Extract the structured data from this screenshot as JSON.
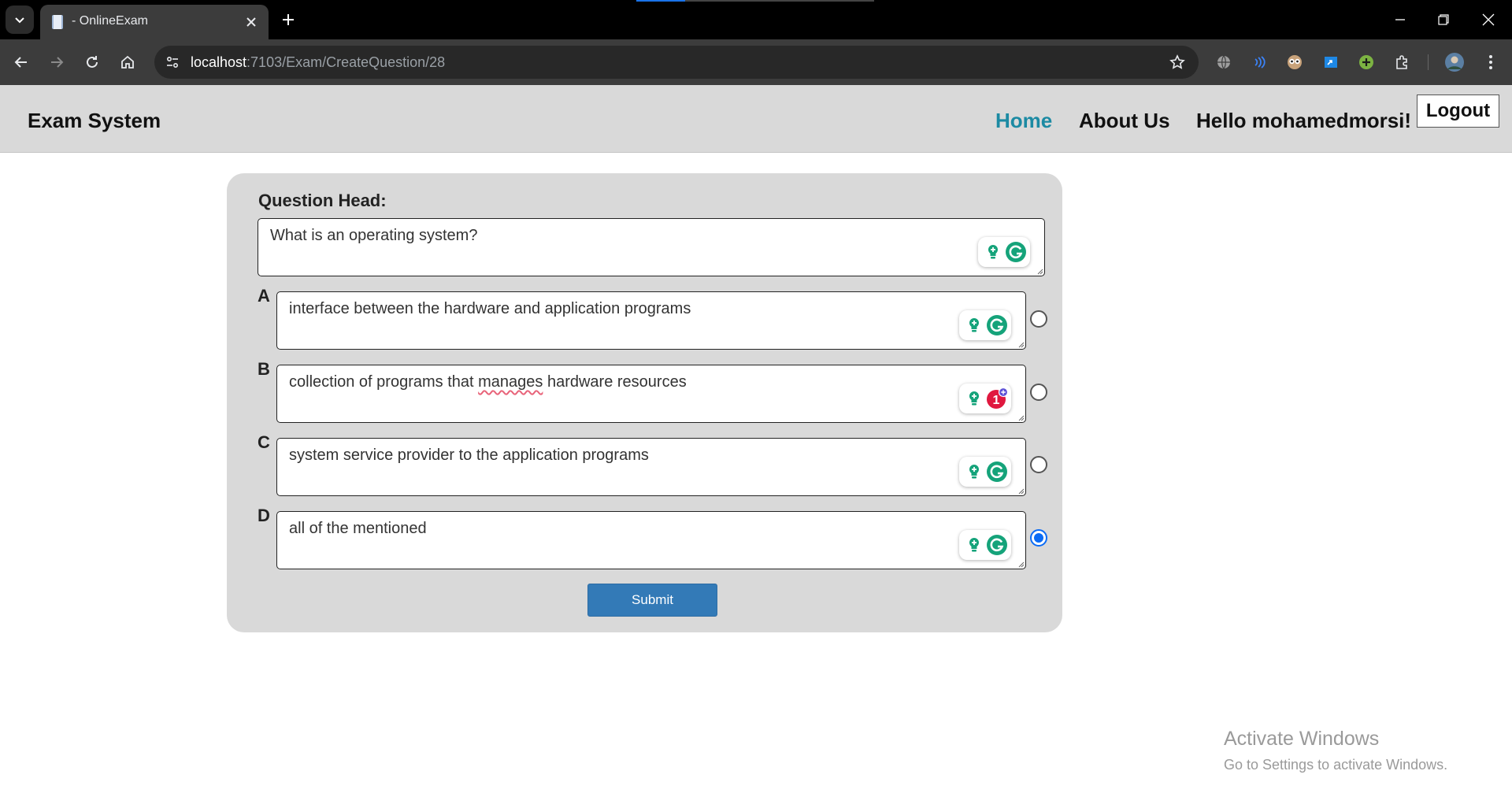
{
  "browser": {
    "tab_title": "- OnlineExam",
    "url_host": "localhost",
    "url_path": ":7103/Exam/CreateQuestion/28"
  },
  "navbar": {
    "brand": "Exam System",
    "home_label": "Home",
    "about_label": "About Us",
    "greeting": "Hello mohamedmorsi!",
    "logout_label": "Logout"
  },
  "form": {
    "question_label": "Question Head:",
    "question_value": "What is an operating system?",
    "options": [
      {
        "letter": "A",
        "text": "interface between the hardware and application programs",
        "selected": false
      },
      {
        "letter": "B",
        "text_before": "collection of programs that ",
        "text_misspelled": "manages",
        "text_after": " hardware resources",
        "selected": false
      },
      {
        "letter": "C",
        "text": "system service provider to the application programs",
        "selected": false
      },
      {
        "letter": "D",
        "text": "all of the mentioned",
        "selected": true
      }
    ],
    "submit_label": "Submit"
  },
  "grammarly": {
    "alert_count": "1"
  },
  "watermark": {
    "title": "Activate Windows",
    "subtitle": "Go to Settings to activate Windows."
  },
  "colors": {
    "accent_link": "#1c8aa3",
    "submit_blue": "#337ab7",
    "radio_blue": "#0b6bf5",
    "grammarly_green": "#15a37a",
    "grammarly_alert": "#e0183f"
  },
  "icons": [
    "tab-list-icon",
    "favicon-icon",
    "close-icon",
    "plus-icon",
    "back-icon",
    "forward-icon",
    "reload-icon",
    "home-icon",
    "site-info-icon",
    "star-icon",
    "globe-icon",
    "extensions-icon",
    "profile-avatar-icon",
    "menu-icon",
    "grammarly-icon",
    "bulb-icon"
  ]
}
